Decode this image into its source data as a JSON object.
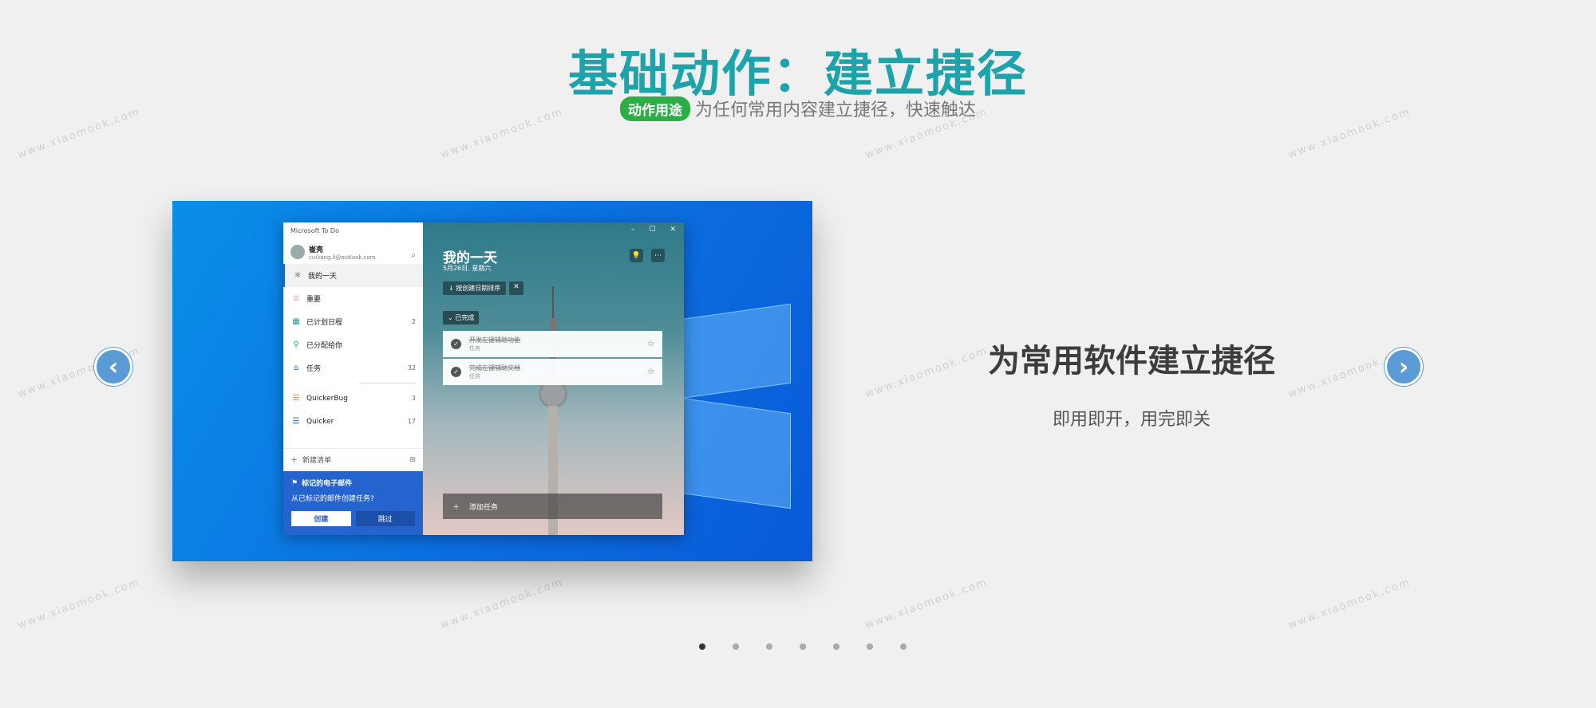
{
  "header": {
    "title": "基础动作：建立捷径",
    "badge": "动作用途",
    "subtitle": "为任何常用内容建立捷径，快速触达"
  },
  "watermark": "www.xiaomook.com",
  "screenshot": {
    "app_title": "Microsoft To Do",
    "user": {
      "name": "崔亮",
      "email": "cuiliang.li@outlook.com"
    },
    "nav": [
      {
        "label": "我的一天",
        "icon": "sun-icon",
        "count": ""
      },
      {
        "label": "重要",
        "icon": "star-icon",
        "count": ""
      },
      {
        "label": "已计划日程",
        "icon": "calendar-icon",
        "count": "2"
      },
      {
        "label": "已分配给你",
        "icon": "person-icon",
        "count": ""
      },
      {
        "label": "任务",
        "icon": "home-icon",
        "count": "32"
      }
    ],
    "lists": [
      {
        "label": "QuickerBug",
        "count": "3"
      },
      {
        "label": "Quicker",
        "count": "17"
      }
    ],
    "new_list": "新建清单",
    "flagged": {
      "title": "标记的电子邮件",
      "desc": "从已标记的邮件创建任务?",
      "create": "创建",
      "skip": "跳过"
    },
    "main": {
      "title": "我的一天",
      "date": "5月26日, 星期六",
      "sort_label": "按创建日期排序",
      "completed_label": "已完成",
      "tasks": [
        {
          "title": "开发左键辅助功能",
          "sub": "任务"
        },
        {
          "title": "完成左键辅助文档",
          "sub": "任务"
        }
      ],
      "add_task": "添加任务"
    }
  },
  "slide": {
    "title": "为常用软件建立捷径",
    "subtitle": "即用即开，用完即关"
  },
  "carousel": {
    "total": 7,
    "active": 1
  }
}
